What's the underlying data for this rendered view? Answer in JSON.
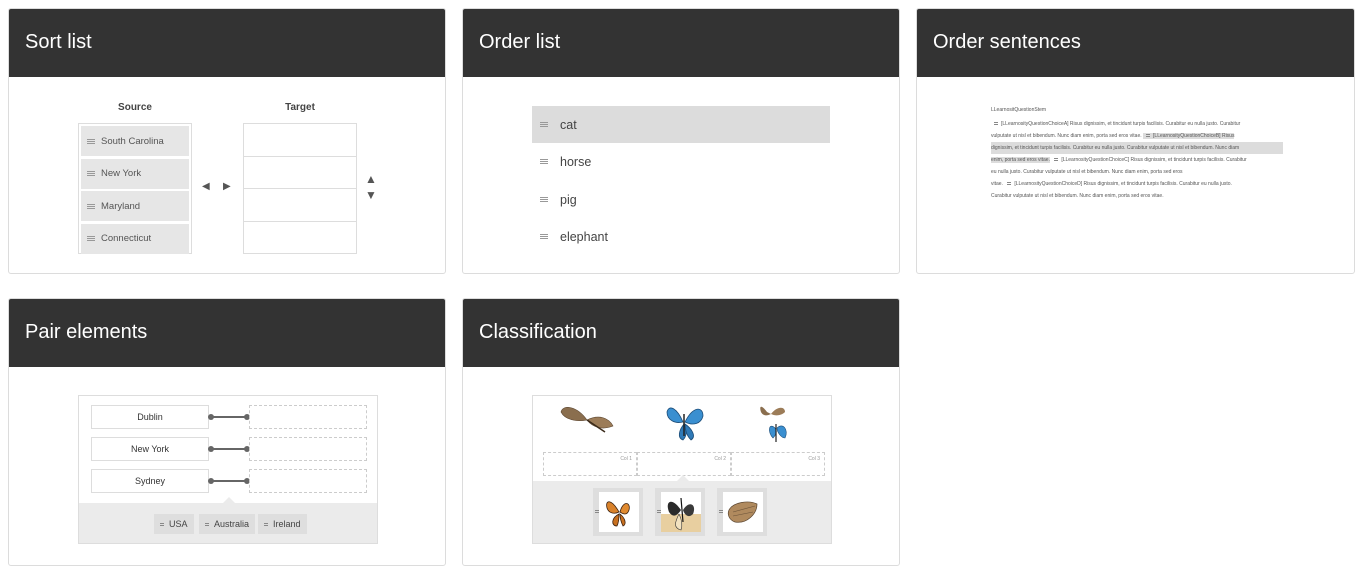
{
  "cards": {
    "sort_list": {
      "title": "Sort list",
      "source_label": "Source",
      "target_label": "Target",
      "items": [
        "South Carolina",
        "New York",
        "Maryland",
        "Connecticut"
      ]
    },
    "order_list": {
      "title": "Order list",
      "items": [
        "cat",
        "horse",
        "pig",
        "elephant"
      ]
    },
    "order_sentences": {
      "title": "Order sentences",
      "stem": "LLearnositQuestionStem",
      "line1": "[LLearnosityQuestionChoiceA] Risus dignissim, et tincidunt turpis facilisis. Curabitur eu nulla justo. Curabitur",
      "line2": "vulputate ut nisl et bibendum. Nunc diam enim, porta sed eros vitae.",
      "line2b": "[LLearnosityQuestionChoiceB] Risus",
      "line3": "dignissim, et tincidunt turpis facilisis. Curabitur eu nulla justo. Curabitur vulputate ut nisl et bibendum. Nunc diam",
      "line4a": "enim, porta sed eros vitae.",
      "line4b": "[LLearnosityQuestionChoiceC] Risus dignissim, et tincidunt turpis facilisis. Curabitur",
      "line5": "eu nulla justo. Curabitur vulputate ut nisl et bibendum. Nunc diam enim, porta sed eros",
      "line6a": "vitae.",
      "line6b": "[LLearnosityQuestionChoiceD] Risus dignissim, et tincidunt turpis facilisis. Curabitur eu nulla justo.",
      "line7": "Curabitur vulputate ut nisl et bibendum. Nunc diam enim, porta sed eros vitae."
    },
    "pair_elements": {
      "title": "Pair elements",
      "left_items": [
        "Dublin",
        "New York",
        "Sydney"
      ],
      "chips": [
        "USA",
        "Australia",
        "Ireland"
      ]
    },
    "classification": {
      "title": "Classification",
      "columns": [
        "Col 1",
        "Col 2",
        "Col 3"
      ]
    }
  }
}
